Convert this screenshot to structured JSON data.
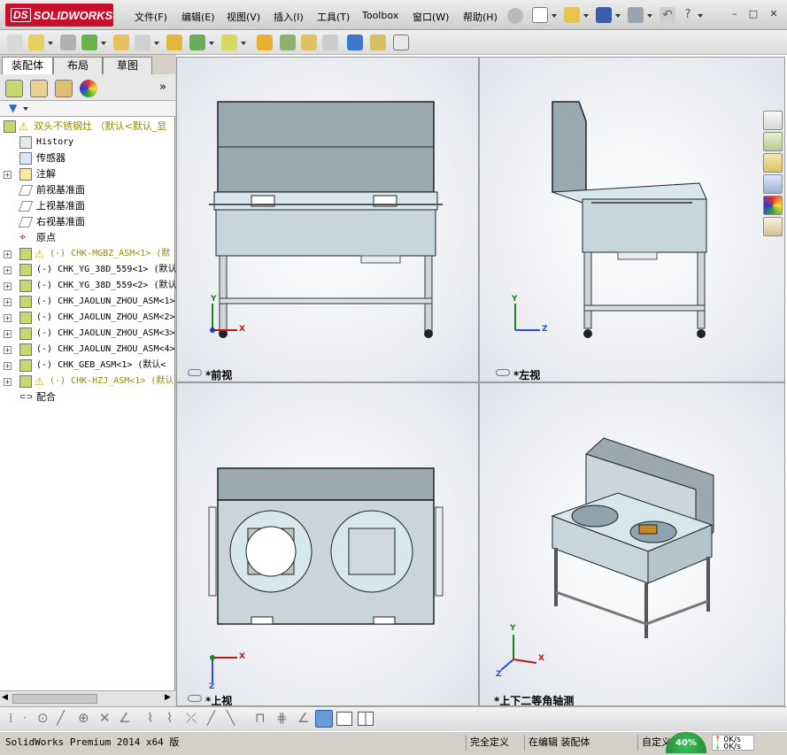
{
  "app": {
    "logo": "SOLIDWORKS",
    "logo_mark": "DS"
  },
  "menu": [
    "文件(F)",
    "编辑(E)",
    "视图(V)",
    "插入(I)",
    "工具(T)",
    "Toolbox",
    "窗口(W)",
    "帮助(H)"
  ],
  "window_controls": {
    "minimize": "–",
    "restore": "□",
    "close": "✕"
  },
  "left_panel": {
    "tabs": [
      "装配体",
      "布局",
      "草图"
    ],
    "expand_more": "»",
    "tree": [
      {
        "label": "双头不锈钢灶  （默认<默认_显",
        "type": "root",
        "warn": true
      },
      {
        "label": "History",
        "type": "history"
      },
      {
        "label": "传感器",
        "type": "sensor"
      },
      {
        "label": "注解",
        "type": "annotation",
        "expand": "+"
      },
      {
        "label": "前视基准面",
        "type": "plane"
      },
      {
        "label": "上视基准面",
        "type": "plane"
      },
      {
        "label": "右视基准面",
        "type": "plane"
      },
      {
        "label": "原点",
        "type": "origin"
      },
      {
        "label": "(-) CHK-MGBZ_ASM<1> (默",
        "type": "asm",
        "warn": true,
        "expand": "+"
      },
      {
        "label": "(-) CHK_YG_38D_559<1> (默认",
        "type": "asm",
        "expand": "+"
      },
      {
        "label": "(-) CHK_YG_38D_559<2> (默认",
        "type": "asm",
        "expand": "+"
      },
      {
        "label": "(-) CHK_JAOLUN_ZHOU_ASM<1>",
        "type": "asm",
        "expand": "+"
      },
      {
        "label": "(-) CHK_JAOLUN_ZHOU_ASM<2>",
        "type": "asm",
        "expand": "+"
      },
      {
        "label": "(-) CHK_JAOLUN_ZHOU_ASM<3>",
        "type": "asm",
        "expand": "+"
      },
      {
        "label": "(-) CHK_JAOLUN_ZHOU_ASM<4>",
        "type": "asm",
        "expand": "+"
      },
      {
        "label": "(-) CHK_GEB_ASM<1> (默认<",
        "type": "asm",
        "expand": "+"
      },
      {
        "label": "(-) CHK-HZJ_ASM<1> (默认",
        "type": "asm",
        "warn": true,
        "expand": "+"
      },
      {
        "label": "配合",
        "type": "mates"
      }
    ]
  },
  "viewports": {
    "front": "*前视",
    "left": "*左视",
    "top": "*上视",
    "iso": "*上下二等角轴测"
  },
  "axes": {
    "x": "X",
    "y": "Y",
    "z": "Z"
  },
  "status": {
    "product": "SolidWorks Premium 2014 x64 版",
    "fully_defined": "完全定义",
    "editing": "在编辑 装配体",
    "custom": "自定义",
    "network": "0K/s",
    "network_up": "0K/s",
    "percent": "40%"
  },
  "colors": {
    "accent": "#c8102e",
    "model_face": "#c8d6dc",
    "model_dark": "#8ea3ad",
    "panel_bg": "#d4d0c8"
  }
}
